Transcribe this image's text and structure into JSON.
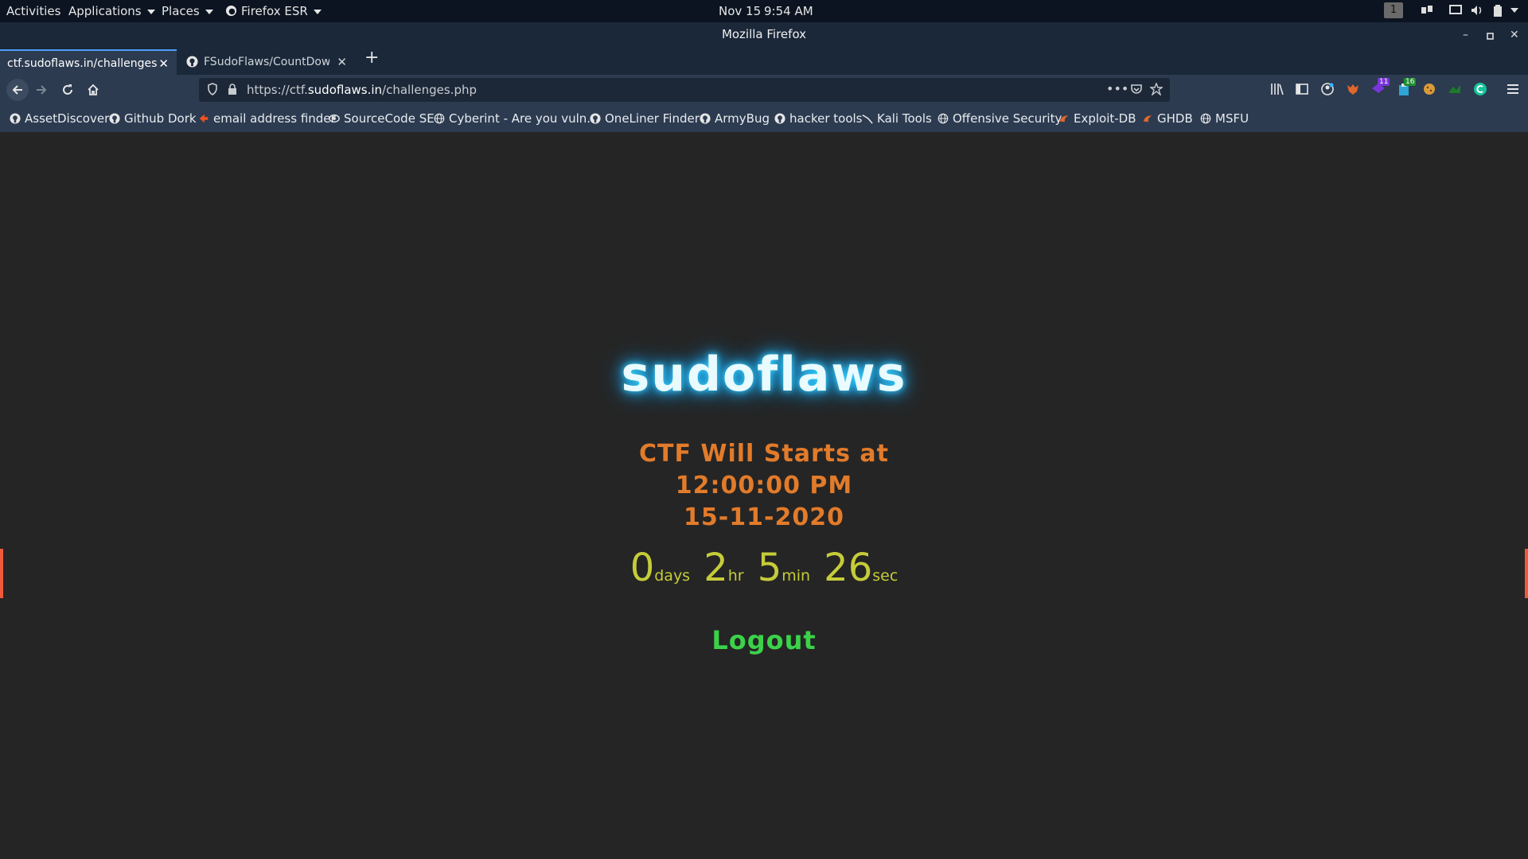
{
  "system_bar": {
    "activities": "Activities",
    "applications": "Applications",
    "places": "Places",
    "firefox_menu": "Firefox ESR",
    "date": "Nov 15",
    "time": "9:54 AM",
    "workspace": "1"
  },
  "window": {
    "title": "Mozilla Firefox"
  },
  "tabs": [
    {
      "label": "ctf.sudoflaws.in/challenges.p",
      "active": true
    },
    {
      "label": "FSudoFlaws/CountDown",
      "active": false
    }
  ],
  "urlbar": {
    "prefix": "https://ctf.",
    "domain": "sudoflaws.in",
    "path": "/challenges.php"
  },
  "extensions": {
    "badge_a": "11",
    "badge_b": "16"
  },
  "bookmarks": [
    {
      "label": "AssetDiscover",
      "icon": "github-icon"
    },
    {
      "label": "Github Dork",
      "icon": "github-icon"
    },
    {
      "label": "email address finder",
      "icon": "hunter-icon"
    },
    {
      "label": "SourceCode SE",
      "icon": "eye-icon"
    },
    {
      "label": "Cyberint - Are you vuln...",
      "icon": "globe-icon"
    },
    {
      "label": "OneLiner Finder",
      "icon": "github-icon"
    },
    {
      "label": "ArmyBug",
      "icon": "github-icon"
    },
    {
      "label": "hacker tools",
      "icon": "github-icon"
    },
    {
      "label": "Kali Tools",
      "icon": "kali-icon"
    },
    {
      "label": "Offensive Security",
      "icon": "globe-icon"
    },
    {
      "label": "Exploit-DB",
      "icon": "exploitdb-icon"
    },
    {
      "label": "GHDB",
      "icon": "exploitdb-icon"
    },
    {
      "label": "MSFU",
      "icon": "globe-icon"
    }
  ],
  "page": {
    "brand": "sudoflaws",
    "starts_line1": "CTF Will Starts at",
    "starts_line2": "12:00:00 PM",
    "starts_line3": "15-11-2020",
    "countdown": {
      "days": "0",
      "days_unit": "days",
      "hours": "2",
      "hours_unit": "hr",
      "minutes": "5",
      "minutes_unit": "min",
      "seconds": "26",
      "seconds_unit": "sec"
    },
    "logout": "Logout"
  },
  "colors": {
    "brand_glow": "#1fb6ff",
    "starts_text": "#e27b2a",
    "countdown_text": "#c5cc39",
    "logout_text": "#3bd24a"
  }
}
